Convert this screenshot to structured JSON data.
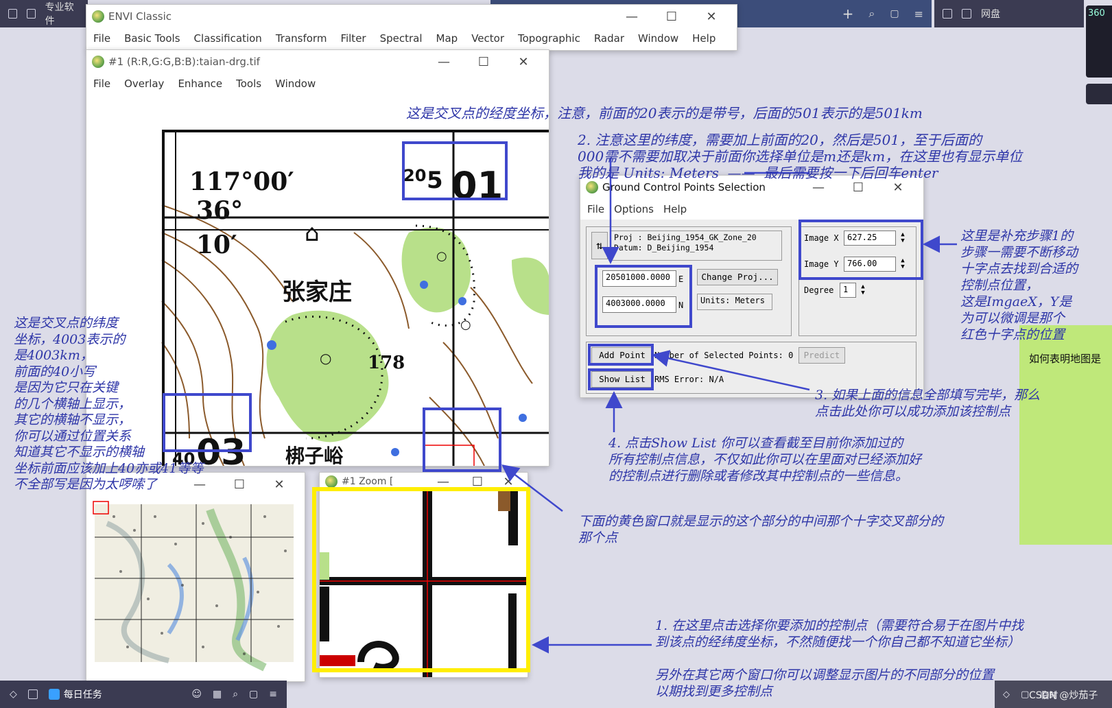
{
  "desktop": {
    "left_tab": "专业软件",
    "right_tab": "网盘",
    "right_edge_label": "360",
    "taskbar_task": "每日任务",
    "bottom_right": "临时",
    "watermark": "CSDN @炒茄子",
    "green_note": "如何表明地图是"
  },
  "envi_main": {
    "title": "ENVI Classic",
    "menus": [
      "File",
      "Basic Tools",
      "Classification",
      "Transform",
      "Filter",
      "Spectral",
      "Map",
      "Vector",
      "Topographic",
      "Radar",
      "Window",
      "Help"
    ]
  },
  "image_window": {
    "title": "#1 (R:R,G:G,B:B):taian-drg.tif",
    "menus": [
      "File",
      "Overlay",
      "Enhance",
      "Tools",
      "Window"
    ],
    "map_labels": {
      "lon_deg": "117°00′",
      "lat_deg": "36°",
      "lat_min": "10′",
      "top_coord_small": "20",
      "top_coord_mid": "5",
      "top_coord_big": "01",
      "left_coord_small": "40",
      "left_coord_big": "03",
      "village": "张家庄",
      "elevation": "178",
      "village2": "梆子峪"
    }
  },
  "zoom_window": {
    "title": "#1 Zoom ["
  },
  "gcp_dialog": {
    "title": "Ground Control Points Selection",
    "menus": [
      "File",
      "Options",
      "Help"
    ],
    "proj_line1": "Proj : Beijing_1954_GK_Zone_20",
    "proj_line2": "Datum: D_Beijing_1954",
    "easting": "20501000.0000",
    "easting_unit": "E",
    "northing": "4003000.0000",
    "northing_unit": "N",
    "change_proj": "Change Proj...",
    "units": "Units: Meters",
    "image_x_label": "Image X",
    "image_x": "627.25",
    "image_y_label": "Image Y",
    "image_y": "766.00",
    "degree_label": "Degree",
    "degree": "1",
    "add_point": "Add Point",
    "selected_points": "Number of Selected Points: 0",
    "predict": "Predict",
    "show_list": "Show List",
    "rms": "RMS Error: N/A"
  },
  "annotations": {
    "top": "这是交叉点的经度坐标，注意，前面的20表示的是带号，后面的501表示的是501km",
    "step2": "2. 注意这里的纬度，需要加上前面的20，然后是501，至于后面的\n000需不需要加取决于前面你选择单位是m还是km，在这里也有显示单位\n我的是 Units: Meters  ——  最后需要按一下后回车enter",
    "left": "这是交叉点的纬度\n坐标，4003表示的\n是4003km，\n前面的40小写\n是因为它只在关键\n的几个横轴上显示，\n其它的横轴不显示，\n你可以通过位置关系\n知道其它不显示的横轴\n坐标前面应该加上40亦或41等等\n不全部写是因为太啰嗦了",
    "right": "这里是补充步骤1的\n步骤一需要不断移动\n十字点去找到合适的\n控制点位置，\n这是ImgaeX，Y是\n为可以微调是那个\n红色十字点的位置",
    "step3": "3. 如果上面的信息全部填写完毕，那么\n点击此处你可以成功添加该控制点",
    "step4": "4. 点击Show List 你可以查看截至目前你添加过的\n所有控制点信息，不仅如此你可以在里面对已经添加好\n的控制点进行删除或者修改其中控制点的一些信息。",
    "zoom_note": "下面的黄色窗口就是显示的这个部分的中间那个十字交叉部分的\n那个点",
    "step1": "1. 在这里点击选择你要添加的控制点（需要符合易于在图片中找\n到该点的经纬度坐标，不然随便找一个你自己都不知道它坐标）\n\n另外在其它两个窗口你可以调整显示图片的不同部分的位置\n以期找到更多控制点"
  }
}
